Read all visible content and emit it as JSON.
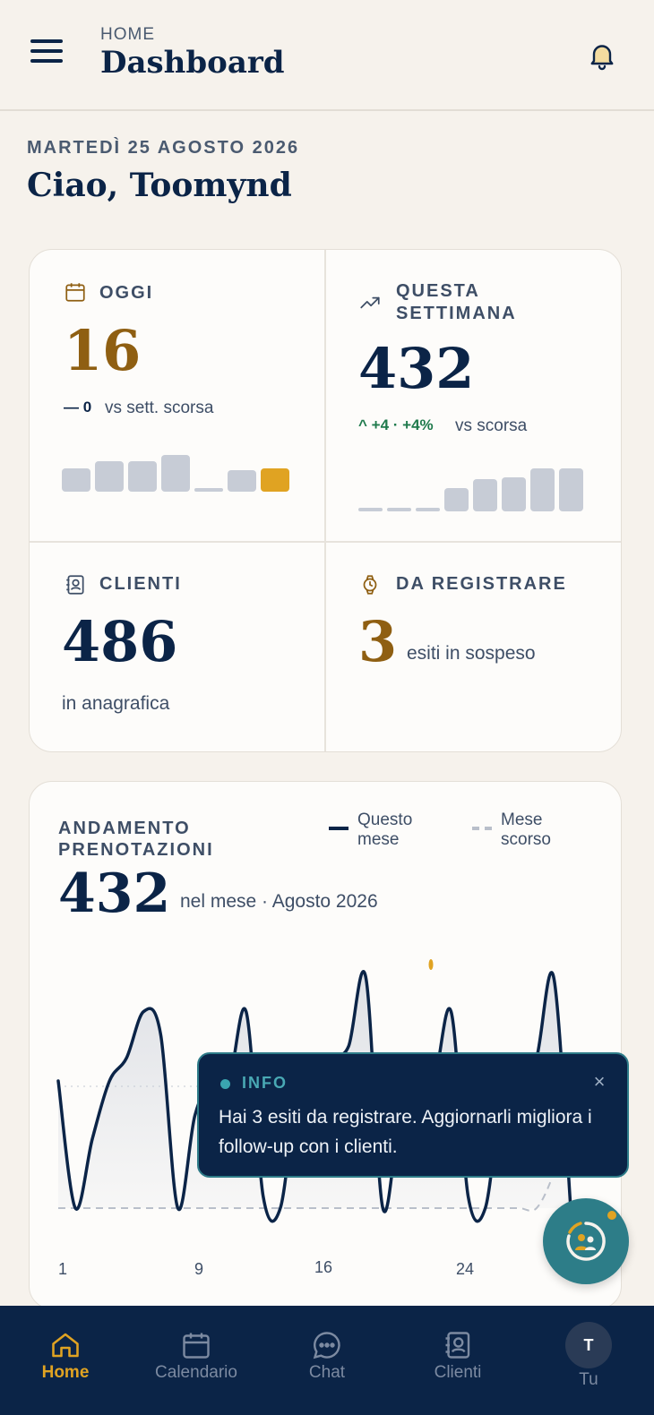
{
  "header": {
    "eyebrow": "HOME",
    "title": "Dashboard"
  },
  "date_line": "MARTEDÌ 25 AGOSTO 2026",
  "greeting": "Ciao, Toomynd",
  "stats": {
    "today": {
      "label": "OGGI",
      "value": "16",
      "delta": "— 0",
      "delta_text": "vs sett. scorsa",
      "bars": [
        0.55,
        0.7,
        0.7,
        0.85,
        0.08,
        0.5,
        0.55
      ],
      "highlight_index": 6
    },
    "week": {
      "label": "QUESTA SETTIMANA",
      "value": "432",
      "delta": "^ +4 · +4%",
      "delta_text": "vs scorsa",
      "bars": [
        0.08,
        0.08,
        0.08,
        0.55,
        0.75,
        0.8,
        1.0,
        1.0
      ]
    },
    "clients": {
      "label": "CLIENTI",
      "value": "486",
      "sub": "in anagrafica"
    },
    "pending": {
      "label": "DA REGISTRARE",
      "value": "3",
      "sub": "esiti in sospeso"
    }
  },
  "chart": {
    "title": "ANDAMENTO PRENOTAZIONI",
    "legend_this": "Questo mese",
    "legend_last": "Mese scorso",
    "total": "432",
    "subtitle": "nel mese · Agosto 2026",
    "x_ticks": [
      "1",
      "9",
      "16",
      "24"
    ]
  },
  "chart_data": {
    "type": "line",
    "x": [
      1,
      2,
      3,
      4,
      5,
      6,
      7,
      8,
      9,
      10,
      11,
      12,
      13,
      14,
      15,
      16,
      17,
      18,
      19,
      20,
      21,
      22,
      23,
      24,
      25,
      26,
      27,
      28,
      29,
      30,
      31
    ],
    "series": [
      {
        "name": "Questo mese",
        "values": [
          11,
          0,
          6,
          11,
          13,
          17,
          15,
          0,
          8,
          11,
          11,
          17,
          1,
          0,
          10,
          11,
          13,
          14,
          20,
          0,
          8,
          11,
          11,
          17,
          1,
          0,
          10,
          11,
          13,
          20,
          0
        ]
      },
      {
        "name": "Mese scorso",
        "values": [
          0,
          0,
          0,
          0,
          0,
          0,
          0,
          0,
          0,
          0,
          0,
          0,
          0,
          0,
          0,
          0,
          0,
          0,
          0,
          0,
          0,
          0,
          0,
          0,
          0,
          0,
          0,
          0,
          0,
          3,
          8
        ]
      }
    ],
    "ylim": [
      0,
      22
    ],
    "grid": true
  },
  "toast": {
    "label": "INFO",
    "message": "Hai 3 esiti da registrare. Aggiornarli migliora i follow-up con i clienti.",
    "close": "×"
  },
  "nav": [
    {
      "label": "Home",
      "icon": "home-icon",
      "active": true
    },
    {
      "label": "Calendario",
      "icon": "calendar-icon"
    },
    {
      "label": "Chat",
      "icon": "chat-icon"
    },
    {
      "label": "Clienti",
      "icon": "contacts-icon"
    },
    {
      "label": "Tu",
      "icon": "avatar",
      "initial": "T"
    }
  ],
  "colors": {
    "navy": "#0b2447",
    "gold": "#e0a322",
    "teal": "#2d7d88"
  }
}
